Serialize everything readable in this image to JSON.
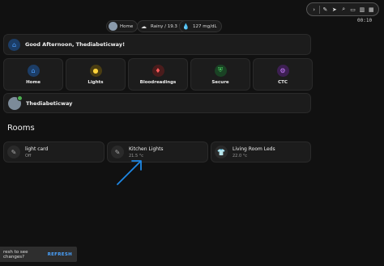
{
  "annotation_toolbar": {
    "time": "00:10"
  },
  "status_chips": [
    {
      "label": "Home",
      "icon": "avatar-icon"
    },
    {
      "label": "Rainy / 19.3 °C",
      "icon": "cloud-icon"
    },
    {
      "label": "127 mg/dL",
      "icon": "drop-icon"
    }
  ],
  "welcome": {
    "text": "Good Afternoon, Thediabeticway!",
    "icon": "home-icon"
  },
  "tiles": [
    {
      "label": "Home",
      "icon": "home-icon",
      "color": "#4a9eff",
      "bg": "#1c3d66"
    },
    {
      "label": "Lights",
      "icon": "bulb-icon",
      "color": "#ffd43b",
      "bg": "#4a3d12"
    },
    {
      "label": "Bloodreadings",
      "icon": "blood-icon",
      "color": "#ff5a5a",
      "bg": "#4a1c1c"
    },
    {
      "label": "Secure",
      "icon": "shield-icon",
      "color": "#4cd964",
      "bg": "#1a4224"
    },
    {
      "label": "CTC",
      "icon": "bike-icon",
      "color": "#c77dff",
      "bg": "#3d1f52"
    }
  ],
  "user": {
    "name": "Thediabeticway"
  },
  "rooms": {
    "title": "Rooms",
    "items": [
      {
        "name": "light card",
        "state": "Off",
        "icon": "pencil-icon"
      },
      {
        "name": "Kitchen Lights",
        "state": "21.5 °c",
        "icon": "pencil-icon"
      },
      {
        "name": "Living Room Leds",
        "state": "22.0 °c",
        "icon": "tshirt-icon"
      }
    ]
  },
  "toast": {
    "text": "resh to see changes?",
    "button": "REFRESH"
  },
  "annotation": {
    "arrow_color": "#1e88e5"
  }
}
